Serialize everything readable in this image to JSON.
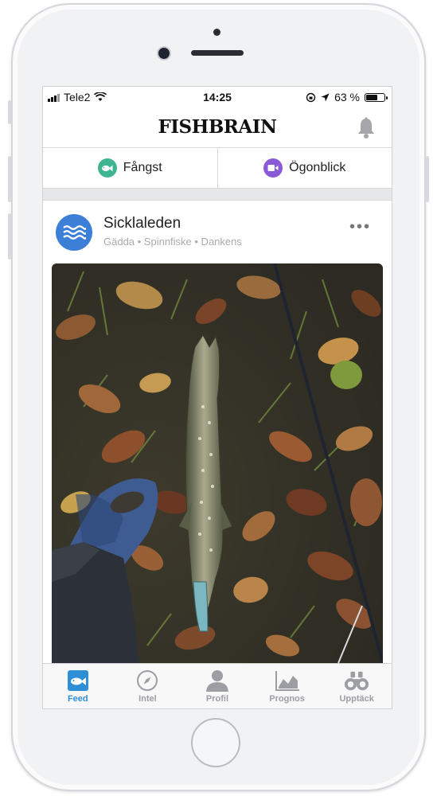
{
  "status_bar": {
    "carrier": "Tele2",
    "time": "14:25",
    "battery_percent": "63 %",
    "battery_level": 0.63
  },
  "header": {
    "logo": "FISHBRAIN"
  },
  "actions": [
    {
      "label": "Fångst",
      "icon": "fish-icon",
      "color": "#3fb58f"
    },
    {
      "label": "Ögonblick",
      "icon": "video-camera-icon",
      "color": "#8b5ad6"
    }
  ],
  "post": {
    "title": "Sicklaleden",
    "subtitle": "Gädda • Spinnfiske • Dankens",
    "avatar_icon": "water-waves-icon",
    "avatar_color": "#3c7fd7",
    "menu_icon": "more-dots-icon"
  },
  "tabbar": {
    "active_color": "#2f8fd6",
    "items": [
      {
        "label": "Feed",
        "icon": "feed-icon",
        "active": true
      },
      {
        "label": "Intel",
        "icon": "compass-icon",
        "active": false
      },
      {
        "label": "Profil",
        "icon": "person-icon",
        "active": false
      },
      {
        "label": "Prognos",
        "icon": "chart-icon",
        "active": false
      },
      {
        "label": "Upptäck",
        "icon": "binoculars-icon",
        "active": false
      }
    ]
  }
}
